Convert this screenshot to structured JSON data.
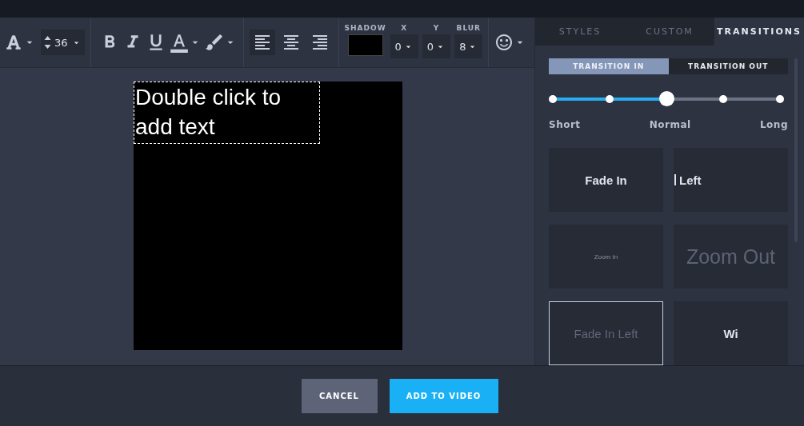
{
  "toolbar": {
    "font_size": "36",
    "format": [
      {
        "kind": "bold"
      },
      {
        "kind": "italic"
      },
      {
        "kind": "underline"
      },
      {
        "kind": "text-color"
      },
      {
        "kind": "highlight"
      }
    ],
    "alignment": [
      {
        "kind": "left",
        "selected": true
      },
      {
        "kind": "center",
        "selected": false
      },
      {
        "kind": "right",
        "selected": false
      }
    ],
    "shadow": {
      "label": "SHADOW",
      "color": "#000000"
    },
    "offsets": [
      {
        "label": "X",
        "value": "0"
      },
      {
        "label": "Y",
        "value": "0"
      },
      {
        "label": "BLUR",
        "value": "8"
      }
    ]
  },
  "canvas": {
    "text": "Double click to add text"
  },
  "panel": {
    "tabs": [
      {
        "label": "STYLES",
        "selected": false
      },
      {
        "label": "CUSTOM",
        "selected": false
      },
      {
        "label": "TRANSITIONS",
        "selected": true
      }
    ],
    "modes": [
      {
        "label": "TRANSITION IN",
        "selected": true
      },
      {
        "label": "TRANSITION OUT",
        "selected": false
      }
    ],
    "speed": {
      "level": 0.5,
      "labels": [
        "Short",
        "Normal",
        "Long"
      ]
    },
    "cards": [
      {
        "label": "Fade In",
        "kind": "plain",
        "selected": false
      },
      {
        "label": "Left",
        "kind": "sliding",
        "selected": false
      },
      {
        "label": "Zoom In",
        "kind": "tiny",
        "selected": false
      },
      {
        "label": "Zoom Out",
        "kind": "large-faded",
        "selected": false
      },
      {
        "label": "Fade In Left",
        "kind": "faded",
        "selected": true
      },
      {
        "label": "Wi",
        "kind": "plain",
        "selected": false
      }
    ]
  },
  "buttons": [
    {
      "label": "CANCEL",
      "kind": "secondary"
    },
    {
      "label": "ADD TO VIDEO",
      "kind": "primary"
    }
  ]
}
